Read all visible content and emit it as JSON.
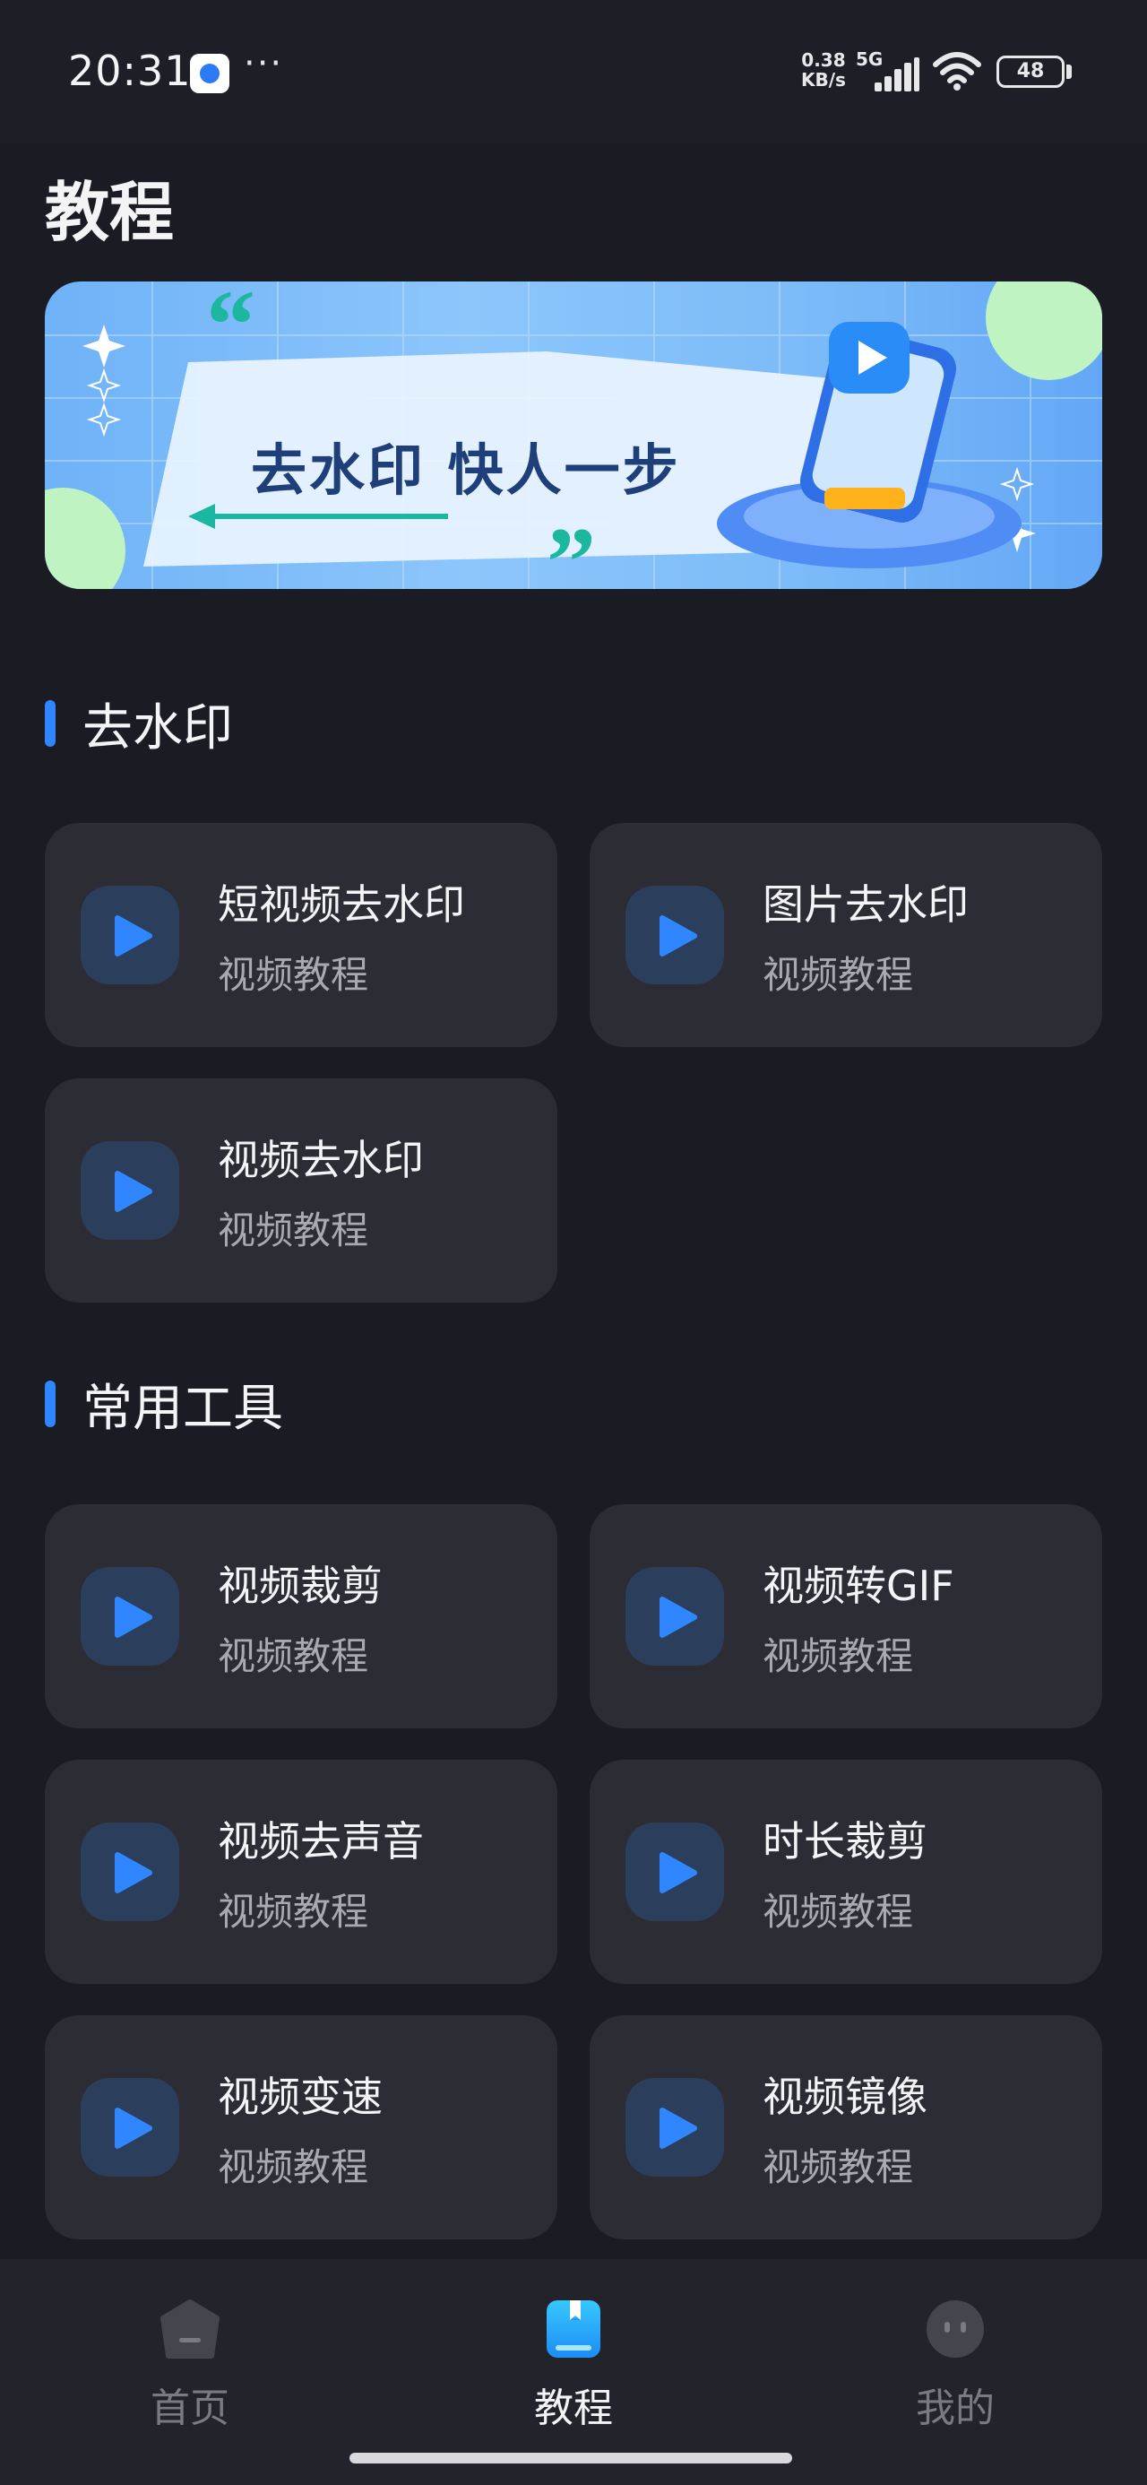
{
  "status_bar": {
    "time": "20:31",
    "dots": "···",
    "net_speed_value": "0.38",
    "net_speed_unit": "KB/s",
    "network": "5G",
    "battery": "48"
  },
  "header": {
    "title": "教程"
  },
  "banner": {
    "text": "去水印 快人一步"
  },
  "sections": [
    {
      "title": "去水印",
      "cards": [
        {
          "title": "短视频去水印",
          "subtitle": "视频教程",
          "icon": "play-icon"
        },
        {
          "title": "图片去水印",
          "subtitle": "视频教程",
          "icon": "play-icon"
        },
        {
          "title": "视频去水印",
          "subtitle": "视频教程",
          "icon": "play-icon"
        }
      ]
    },
    {
      "title": "常用工具",
      "cards": [
        {
          "title": "视频裁剪",
          "subtitle": "视频教程",
          "icon": "play-icon"
        },
        {
          "title": "视频转GIF",
          "subtitle": "视频教程",
          "icon": "play-icon"
        },
        {
          "title": "视频去声音",
          "subtitle": "视频教程",
          "icon": "play-icon"
        },
        {
          "title": "时长裁剪",
          "subtitle": "视频教程",
          "icon": "play-icon"
        },
        {
          "title": "视频变速",
          "subtitle": "视频教程",
          "icon": "play-icon"
        },
        {
          "title": "视频镜像",
          "subtitle": "视频教程",
          "icon": "play-icon"
        }
      ]
    }
  ],
  "bottom_nav": {
    "items": [
      {
        "label": "首页",
        "icon": "home-icon",
        "active": false
      },
      {
        "label": "教程",
        "icon": "tutorial-book-icon",
        "active": true
      },
      {
        "label": "我的",
        "icon": "profile-icon",
        "active": false
      }
    ]
  },
  "colors": {
    "background": "#1b1b24",
    "card": "#2c2c35",
    "accent": "#2f86ff",
    "muted_text": "#a9a9b0"
  }
}
